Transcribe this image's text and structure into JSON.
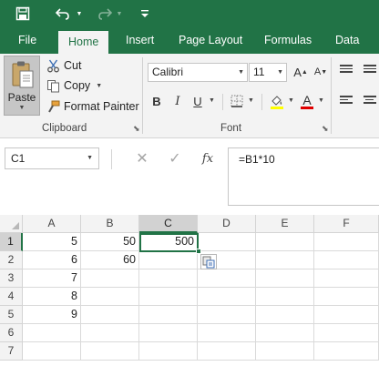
{
  "quick_access": {
    "save_icon": "save-icon",
    "undo_icon": "undo-icon",
    "redo_icon": "redo-icon",
    "customize_icon": "customize-quick-access-icon"
  },
  "tabs": [
    "File",
    "Home",
    "Insert",
    "Page Layout",
    "Formulas",
    "Data"
  ],
  "active_tab": "Home",
  "clipboard": {
    "paste_label": "Paste",
    "cut_label": "Cut",
    "copy_label": "Copy",
    "format_painter_label": "Format Painter",
    "group_label": "Clipboard"
  },
  "font": {
    "font_name": "Calibri",
    "font_size": "11",
    "bold": "B",
    "italic": "I",
    "underline": "U",
    "font_color_glyph": "A",
    "group_label": "Font"
  },
  "formula_bar": {
    "name_box": "C1",
    "cancel_glyph": "✕",
    "enter_glyph": "✓",
    "fx_label": "fx",
    "formula": "=B1*10"
  },
  "columns": [
    "A",
    "B",
    "C",
    "D",
    "E",
    "F"
  ],
  "selected_column": "C",
  "rows": [
    "1",
    "2",
    "3",
    "4",
    "5",
    "6",
    "7"
  ],
  "selected_row": "1",
  "cells": {
    "A1": "5",
    "B1": "50",
    "C1": "500",
    "A2": "6",
    "B2": "60",
    "A3": "7",
    "A4": "8",
    "A5": "9"
  },
  "colors": {
    "accent": "#217346",
    "ribbon_bg": "#f3f3f3",
    "header_selected": "#d2d2d2",
    "font_color_underline": "#e00000",
    "highlight_underline": "#ffff00"
  }
}
